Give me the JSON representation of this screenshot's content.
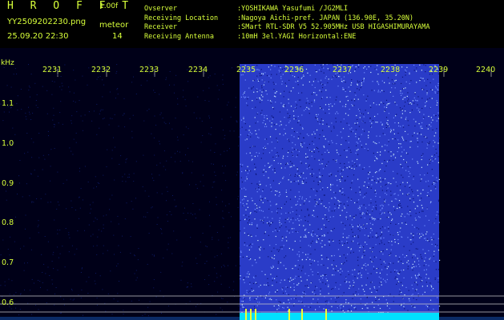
{
  "header": {
    "title": "H R O F F T",
    "version": "1.00f",
    "filename": "YY2509202230.png",
    "meteor_label": "meteor",
    "datetime": "25.09.20 22:30",
    "meteor_count": "14"
  },
  "info": [
    {
      "key": "Ovserver",
      "value": ":YOSHIKAWA Yasufumi /JG2MLI"
    },
    {
      "key": "Receiving Location",
      "value": ":Nagoya Aichi-pref. JAPAN (136.90E, 35.20N)"
    },
    {
      "key": "Receiver",
      "value": ":SMart RTL-SDR V5 52.905MHz USB HIGASHIMURAYAMA"
    },
    {
      "key": "Receiving Antenna",
      "value": ":10mH 3el.YAGI Horizontal:ENE"
    }
  ],
  "axis": {
    "y_unit": "kHz",
    "x_ticks": [
      "2231",
      "2232",
      "2233",
      "2234",
      "2235",
      "2236",
      "2237",
      "2238",
      "2239",
      "2240"
    ],
    "y_ticks": [
      "1.1",
      "1.0",
      "0.9",
      "0.8",
      "0.7",
      "0.6"
    ]
  },
  "colors": {
    "text": "#d8ff3a",
    "background": "#000018",
    "active_band": "#2a3cc8",
    "baseline": "#00e0ff",
    "marker_lines": "#c8c8c8"
  }
}
